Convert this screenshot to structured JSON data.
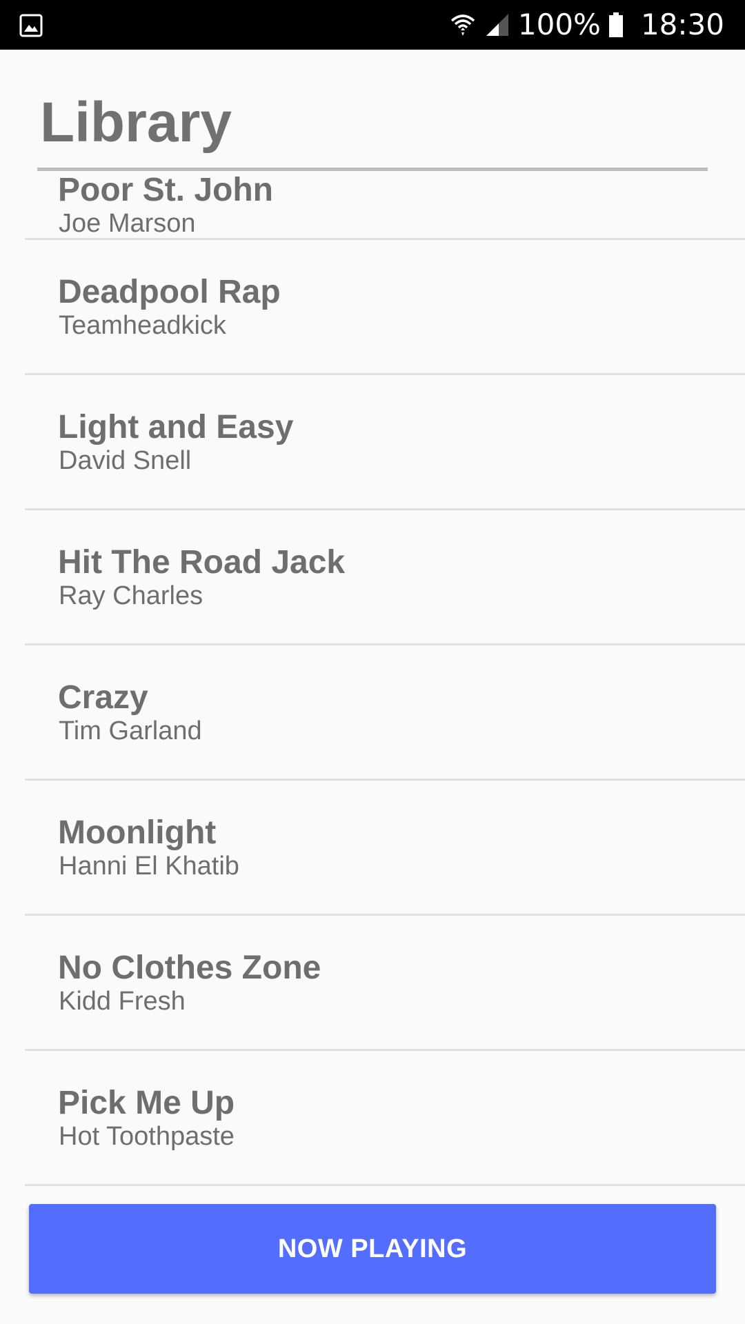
{
  "status_bar": {
    "left_icon": "gallery-icon",
    "wifi_icon": "wifi-icon",
    "signal_icon": "cell-signal-icon",
    "battery_icon": "battery-icon",
    "battery_percent": "100%",
    "time": "18:30"
  },
  "header": {
    "title": "Library"
  },
  "tracks": [
    {
      "title": "Poor St. John",
      "artist": "Joe Marson"
    },
    {
      "title": "Deadpool Rap",
      "artist": "Teamheadkick"
    },
    {
      "title": "Light and Easy",
      "artist": "David Snell"
    },
    {
      "title": "Hit The Road Jack",
      "artist": "Ray Charles"
    },
    {
      "title": "Crazy",
      "artist": "Tim Garland"
    },
    {
      "title": "Moonlight",
      "artist": "Hanni El Khatib"
    },
    {
      "title": "No Clothes Zone",
      "artist": "Kidd Fresh"
    },
    {
      "title": "Pick Me Up",
      "artist": "Hot Toothpaste"
    }
  ],
  "now_playing": {
    "label": "NOW PLAYING"
  },
  "colors": {
    "accent": "#536dfe",
    "status_bar": "#000000",
    "background": "#fafafa",
    "text": "#6e6e6e",
    "divider": "#e0e0e0"
  }
}
